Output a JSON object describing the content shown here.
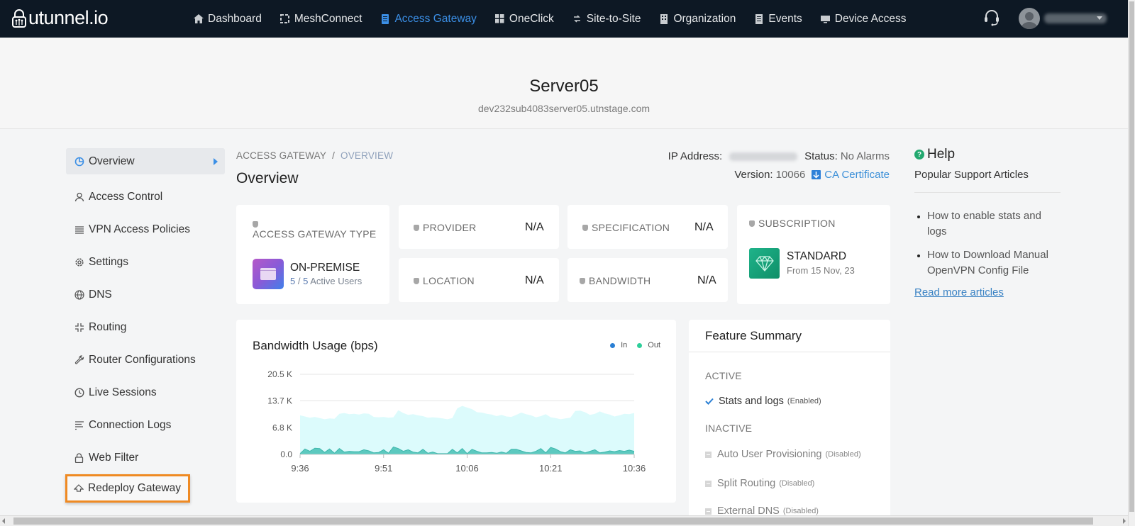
{
  "brand": {
    "name": "utunnel.io"
  },
  "nav": {
    "items": [
      {
        "label": "Dashboard",
        "icon": "home-icon"
      },
      {
        "label": "MeshConnect",
        "icon": "mesh-icon"
      },
      {
        "label": "Access Gateway",
        "icon": "gateway-icon",
        "active": true
      },
      {
        "label": "OneClick",
        "icon": "grid-icon"
      },
      {
        "label": "Site-to-Site",
        "icon": "arrows-icon"
      },
      {
        "label": "Organization",
        "icon": "building-icon"
      },
      {
        "label": "Events",
        "icon": "list-icon"
      },
      {
        "label": "Device Access",
        "icon": "monitor-icon"
      }
    ],
    "support_icon": "headset-icon",
    "user_name": "(blurred)"
  },
  "server": {
    "title": "Server05",
    "hostname": "dev232sub4083server05.utnstage.com"
  },
  "sidebar": {
    "items": [
      {
        "label": "Overview",
        "icon": "pie-chart-icon",
        "active": true
      },
      {
        "label": "Access Control",
        "icon": "user-icon"
      },
      {
        "label": "VPN Access Policies",
        "icon": "list-icon"
      },
      {
        "label": "Settings",
        "icon": "gear-icon"
      },
      {
        "label": "DNS",
        "icon": "globe-icon"
      },
      {
        "label": "Routing",
        "icon": "routing-icon"
      },
      {
        "label": "Router Configurations",
        "icon": "wrench-icon"
      },
      {
        "label": "Live Sessions",
        "icon": "clock-icon"
      },
      {
        "label": "Connection Logs",
        "icon": "lines-icon"
      },
      {
        "label": "Web Filter",
        "icon": "lock-icon"
      },
      {
        "label": "Redeploy Gateway",
        "icon": "upload-arrow-icon",
        "highlighted": true
      }
    ]
  },
  "breadcrumb": {
    "parent": "ACCESS GATEWAY",
    "separator": "/",
    "current": "OVERVIEW"
  },
  "page_title": "Overview",
  "meta": {
    "ip_label": "IP Address:",
    "ip_value": "(blurred)",
    "status_label": "Status:",
    "status_value": "No Alarms",
    "version_label": "Version:",
    "version_value": "10066",
    "ca_cert_label": "CA Certificate"
  },
  "cards": {
    "type": {
      "label": "ACCESS GATEWAY TYPE",
      "name": "ON-PREMISE",
      "users_active": "5",
      "users_total": "5",
      "users_suffix": "Active Users",
      "users_sep": "/"
    },
    "provider": {
      "label": "PROVIDER",
      "value": "N/A"
    },
    "location": {
      "label": "LOCATION",
      "value": "N/A"
    },
    "specification": {
      "label": "SPECIFICATION",
      "value": "N/A"
    },
    "bandwidth": {
      "label": "BANDWIDTH",
      "value": "N/A"
    },
    "subscription": {
      "label": "SUBSCRIPTION",
      "plan": "STANDARD",
      "from": "From 15 Nov, 23"
    }
  },
  "chart_data": {
    "type": "area",
    "title": "Bandwidth Usage (bps)",
    "xlabel": "",
    "ylabel": "",
    "x_ticks": [
      "9:36",
      "9:51",
      "10:06",
      "10:21",
      "10:36"
    ],
    "y_ticks": [
      "0.0",
      "6.8 K",
      "13.7 K",
      "20.5 K"
    ],
    "ylim": [
      0,
      20500
    ],
    "grid": true,
    "legend_position": "top-right",
    "series": [
      {
        "name": "In",
        "color": "#2a7fd4",
        "fill": "#dcfbfc",
        "values": [
          10000,
          9700,
          9400,
          9600,
          9300,
          9000,
          9200,
          9100,
          10400,
          10600,
          10300,
          10400,
          10200,
          10500,
          10400,
          9600,
          9500,
          9600,
          9400,
          9500,
          11300,
          10600,
          10100,
          10300,
          10000,
          9800,
          9400,
          9500,
          9400,
          9200,
          9000,
          9300,
          11800,
          12400,
          12000,
          11600,
          10800,
          10700,
          10400,
          10200,
          9800,
          10100,
          9700,
          9600,
          10100,
          10700,
          10300,
          10000,
          9500,
          9800,
          10300,
          9500,
          9300,
          9000,
          9200,
          9400,
          11100,
          11200,
          10800,
          10100,
          10400,
          11000,
          10500,
          10200,
          9700,
          10000,
          10400,
          10300,
          10600
        ]
      },
      {
        "name": "Out",
        "color": "#2ecf9a",
        "fill": "#5cc9bf",
        "values": [
          200,
          1400,
          800,
          1600,
          1500,
          500,
          1400,
          300,
          1500,
          600,
          800,
          700,
          700,
          1200,
          900,
          400,
          500,
          1200,
          300,
          1900,
          1500,
          800,
          1200,
          600,
          400,
          1300,
          300,
          600,
          200,
          200,
          200,
          1300,
          400,
          1500,
          200,
          1300,
          800,
          400,
          400,
          500,
          300,
          600,
          300,
          1300,
          1300,
          900,
          500,
          400,
          800,
          1500,
          400,
          1800,
          1400,
          700,
          400,
          1200,
          800,
          900,
          400,
          800,
          1200,
          400,
          600,
          900,
          700,
          1000,
          800,
          1100,
          800
        ]
      }
    ]
  },
  "features": {
    "title": "Feature Summary",
    "active_label": "ACTIVE",
    "inactive_label": "INACTIVE",
    "active": [
      {
        "name": "Stats and logs",
        "state": "(Enabled)"
      }
    ],
    "inactive": [
      {
        "name": "Auto User Provisioning",
        "state": "(Disabled)"
      },
      {
        "name": "Split Routing",
        "state": "(Disabled)"
      },
      {
        "name": "External DNS",
        "state": "(Disabled)"
      }
    ]
  },
  "help": {
    "title": "Help",
    "subtitle": "Popular Support Articles",
    "articles": [
      "How to enable stats and logs",
      "How to Download Manual OpenVPN Config File"
    ],
    "more_label": "Read more articles"
  },
  "colors": {
    "accent": "#3b8fe6",
    "nav_bg": "#0d1824",
    "highlight": "#ef8a23",
    "help_icon": "#22a86f"
  }
}
